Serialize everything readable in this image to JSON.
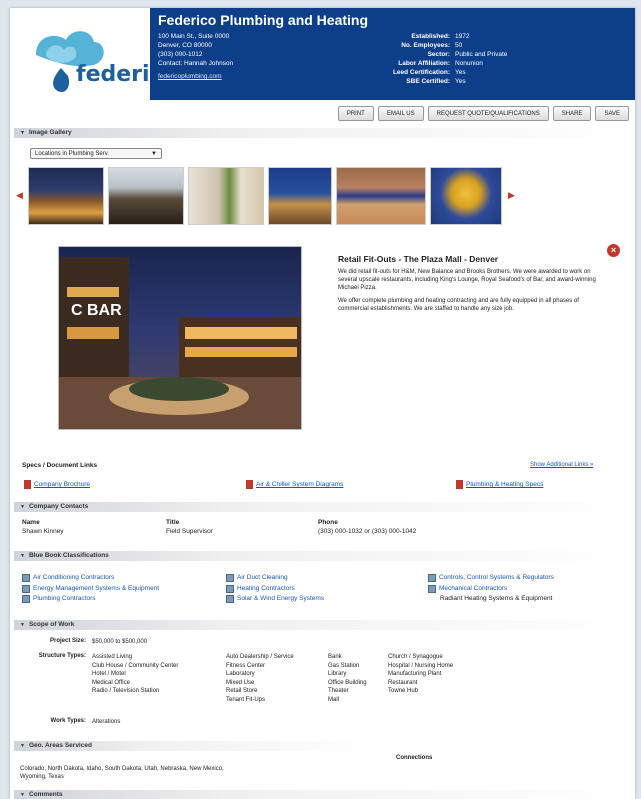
{
  "company": {
    "logo_text": "federico",
    "name": "Federico Plumbing and Heating",
    "address_lines": [
      "100 Main St., Suite 0000",
      "Denver, CO 80000"
    ],
    "phone": "(303) 000-1012",
    "contact_line": "Contact: Hannah Johnson",
    "website": "federicoplumbing.com"
  },
  "facts": [
    {
      "k": "Established:",
      "v": "1972"
    },
    {
      "k": "No. Employees:",
      "v": "50"
    },
    {
      "k": "Sector:",
      "v": "Public and Private"
    },
    {
      "k": "Labor Affiliation:",
      "v": "Nonunion"
    },
    {
      "k": "Leed Certification:",
      "v": "Yes"
    },
    {
      "k": "SBE Certified:",
      "v": "Yes"
    }
  ],
  "toolbar": [
    "PRINT",
    "EMAIL US",
    "REQUEST QUOTE/QUALIFICATIONS",
    "SHARE",
    "SAVE"
  ],
  "sections": {
    "image_gallery": "Image Gallery",
    "company_contacts": "Company Contacts",
    "classifications": "Blue Book Classifications",
    "scope": "Scope of Work",
    "areas": "Geo. Areas Serviced",
    "comments": "Comments"
  },
  "gallery": {
    "select_value": "Locations in Plumbing Serv.",
    "prev": "◀",
    "next": "▶"
  },
  "feature": {
    "title": "Retail Fit-Outs - The Plaza Mall - Denver",
    "paragraphs": [
      "We did retail fit-outs for H&M, New Balance and Brooks Brothers. We were awarded to work on several upscale restaurants, including King's Lounge, Royal Seafood's of Bar, and award-winning Michael Pizza.",
      "We offer complete plumbing and heating contracting and are fully equipped in all phases of commercial establishments. We are staffed to handle any size job."
    ],
    "close_icon": "×"
  },
  "docs": {
    "header": "Specs / Document Links",
    "more": "Show Additional Links »",
    "items": [
      "Company Brochure",
      "Air & Chiller System Diagrams",
      "Plumbing & Heating Specs"
    ]
  },
  "contacts": {
    "name_hdr": "Name",
    "title_hdr": "Title",
    "phone_hdr": "Phone",
    "name": "Shawn Kinney",
    "title": "Field Supervisor",
    "phone": "(303) 000-1032 or (303) 000-1042"
  },
  "classifications": {
    "col1": [
      "Air Conditioning Contractors",
      "Energy Management Systems & Equipment",
      "Plumbing Contractors"
    ],
    "col2": [
      "Air Duct Cleaning",
      "Heating Contractors",
      "Solar & Wind Energy Systems"
    ],
    "col3": [
      "Controls, Control Systems & Regulators",
      "Mechanical Contractors",
      "Radiant Heating Systems & Equipment"
    ]
  },
  "scope": {
    "project_size_lbl": "Project Size:",
    "project_size": "$50,000 to $500,000",
    "structure_lbl": "Structure Types:",
    "work_lbl": "Work Types:",
    "work": "Alterations",
    "col1": [
      "Assisted Living",
      "Club House / Community Center",
      "Hotel / Motel",
      "Medical Office",
      "Radio / Television Station"
    ],
    "col2": [
      "Auto Dealership / Service",
      "Fitness Center",
      "Laboratory",
      "Mixed Use",
      "Retail Store",
      "Tenant Fit-Ups"
    ],
    "col3": [
      "Bank",
      "Gas Station",
      "Library",
      "Office Building",
      "Theater",
      "Mall"
    ],
    "col4": [
      "Church / Synagogue",
      "Hospital / Nursing Home",
      "Manufacturing Plant",
      "Restaurant",
      "Towne Hub"
    ]
  },
  "areas": {
    "states": "Colorado, North Dakota, Idaho, South Dakota, Utah, Nebraska, New Mexico, Wyoming, Texas",
    "right_header": "Connections"
  },
  "colors": {
    "header_bg": "#0d3e8a",
    "link": "#1a55b5",
    "close": "#c0392b"
  }
}
